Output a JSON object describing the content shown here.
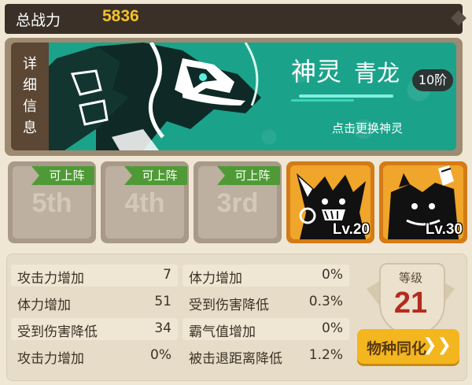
{
  "power": {
    "label": "总战力",
    "value": "5836"
  },
  "spirit": {
    "detail_tab": [
      "详",
      "细",
      "信",
      "息"
    ],
    "name_part1": "神灵",
    "name_part2": "青龙",
    "rank": "10阶",
    "change_hint": "点击更换神灵"
  },
  "slots": [
    {
      "order": "5th",
      "ribbon": "可上阵",
      "state": "locked"
    },
    {
      "order": "4th",
      "ribbon": "可上阵",
      "state": "locked"
    },
    {
      "order": "3rd",
      "ribbon": "可上阵",
      "state": "locked"
    },
    {
      "level": "Lv.20",
      "state": "filled",
      "icon": "black-beast-icon"
    },
    {
      "level": "Lv.30",
      "state": "filled",
      "icon": "black-mech-beast-icon"
    }
  ],
  "stats_left": [
    {
      "name": "攻击力增加",
      "value": "7"
    },
    {
      "name": "体力增加",
      "value": "51"
    },
    {
      "name": "受到伤害降低",
      "value": "34"
    },
    {
      "name": "攻击力增加",
      "value": "0%"
    }
  ],
  "stats_right": [
    {
      "name": "体力增加",
      "value": "0%"
    },
    {
      "name": "受到伤害降低",
      "value": "0.3%"
    },
    {
      "name": "霸气值增加",
      "value": "0%"
    },
    {
      "name": "被击退距离降低",
      "value": "1.2%"
    }
  ],
  "level": {
    "label": "等级",
    "value": "21"
  },
  "sync_button": {
    "label": "物种同化",
    "arrow": "❯❯"
  },
  "colors": {
    "teal": "#1aa38a",
    "gold": "#f3c02b",
    "level_red": "#b42b1e",
    "ribbon_green": "#4f9a36",
    "slot_orange": "#d47a16"
  }
}
